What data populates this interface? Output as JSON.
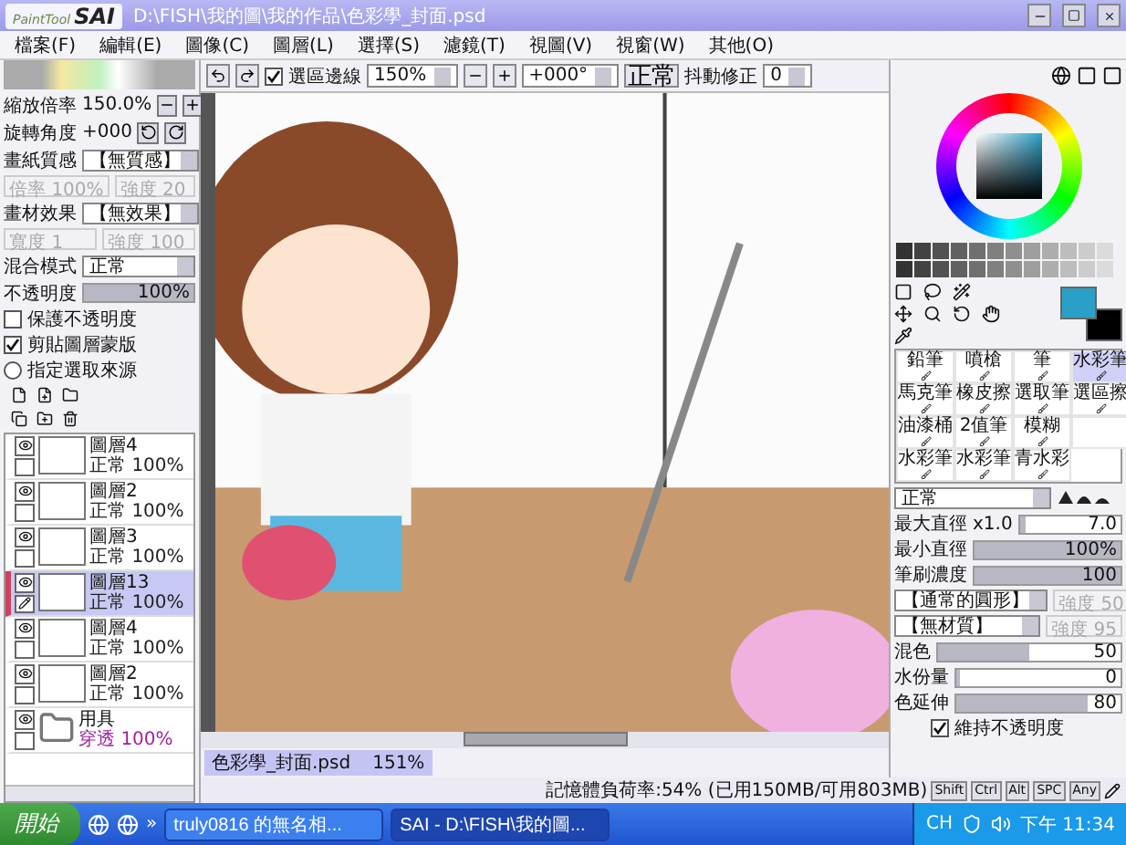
{
  "window": {
    "logo_small": "PaintTool",
    "logo": "SAI",
    "title": "D:\\FISH\\我的圖\\我的作品\\色彩學_封面.psd"
  },
  "menu": [
    "檔案(F)",
    "編輯(E)",
    "圖像(C)",
    "圖層(L)",
    "選擇(S)",
    "濾鏡(T)",
    "視圖(V)",
    "視窗(W)",
    "其他(O)"
  ],
  "toolbar": {
    "selection_edge": {
      "label": "選區邊線",
      "checked": true
    },
    "zoom": "150%",
    "rotation": "+000°",
    "blend": "正常",
    "stabilizer_label": "抖動修正",
    "stabilizer": "0"
  },
  "navigator": {
    "zoom_label": "縮放倍率",
    "zoom": "150.0%",
    "rotate_label": "旋轉角度",
    "rotate": "+000"
  },
  "paper": {
    "label": "畫紙質感",
    "value": "【無質感】",
    "fields": [
      {
        "label": "倍率",
        "value": "100%"
      },
      {
        "label": "強度",
        "value": "20"
      }
    ]
  },
  "effect": {
    "label": "畫材效果",
    "value": "【無效果】",
    "fields": [
      {
        "label": "寬度",
        "value": "1"
      },
      {
        "label": "強度",
        "value": "100"
      }
    ]
  },
  "layer_props": {
    "blend_label": "混合模式",
    "blend": "正常",
    "opacity_label": "不透明度",
    "opacity": "100%",
    "opacity_level": {
      "level": 1
    },
    "options": [
      {
        "kind": "checkbox",
        "label": "保護不透明度",
        "checked": false
      },
      {
        "kind": "checkbox",
        "label": "剪貼圖層蒙版",
        "checked": true
      },
      {
        "kind": "radio",
        "label": "指定選取來源",
        "checked": false
      }
    ]
  },
  "layers": [
    {
      "kind": "layer",
      "name": "圖層4",
      "mode": "正常",
      "opacity": "100%",
      "selected": false
    },
    {
      "kind": "layer",
      "name": "圖層2",
      "mode": "正常",
      "opacity": "100%",
      "selected": false
    },
    {
      "kind": "layer",
      "name": "圖層3",
      "mode": "正常",
      "opacity": "100%",
      "selected": false
    },
    {
      "kind": "layer",
      "name": "圖層13",
      "mode": "正常",
      "opacity": "100%",
      "selected": true
    },
    {
      "kind": "layer",
      "name": "圖層4",
      "mode": "正常",
      "opacity": "100%",
      "selected": false
    },
    {
      "kind": "layer",
      "name": "圖層2",
      "mode": "正常",
      "opacity": "100%",
      "selected": false
    },
    {
      "kind": "folder",
      "name": "用具",
      "mode": "穿透",
      "opacity": "100%",
      "selected": false
    }
  ],
  "file_tabs": [
    {
      "name": "色彩學_封面.psd",
      "zoom": "151%",
      "selected": true
    }
  ],
  "tools": [
    {
      "name": "鉛筆",
      "selected": false
    },
    {
      "name": "噴槍",
      "selected": false
    },
    {
      "name": "筆",
      "selected": false
    },
    {
      "name": "水彩筆",
      "selected": true
    },
    {
      "name": "馬克筆",
      "selected": false
    },
    {
      "name": "橡皮擦",
      "selected": false
    },
    {
      "name": "選取筆",
      "selected": false
    },
    {
      "name": "選區擦",
      "selected": false
    },
    {
      "name": "油漆桶",
      "selected": false
    },
    {
      "name": "2值筆",
      "selected": false
    },
    {
      "name": "模糊",
      "selected": false
    },
    {
      "selected": false
    },
    {
      "name": "水彩筆",
      "selected": false
    },
    {
      "name": "水彩筆",
      "selected": false
    },
    {
      "name": "青水彩",
      "selected": false
    }
  ],
  "brush": {
    "mode": "正常",
    "sliders": [
      {
        "label": "最大直徑",
        "extra": "x1.0",
        "value": "7.0",
        "level": 0.05
      },
      {
        "label": "最小直徑",
        "value": "100%",
        "level": 1
      },
      {
        "label": "筆刷濃度",
        "value": "100",
        "level": 1
      }
    ],
    "shapes": [
      {
        "value": "【通常的圓形】",
        "strength_label": "強度",
        "strength": "50"
      },
      {
        "value": "【無材質】",
        "strength_label": "強度",
        "strength": "95"
      }
    ],
    "mix": [
      {
        "label": "混色",
        "value": "50",
        "level": 0.5
      },
      {
        "label": "水份量",
        "value": "0",
        "level": 0
      },
      {
        "label": "色延伸",
        "value": "80",
        "level": 0.8
      }
    ],
    "keep_opacity": {
      "label": "維持不透明度",
      "checked": true
    }
  },
  "status": {
    "memory": "記憶體負荷率:54% (已用150MB/可用803MB)",
    "keys": [
      "Shift",
      "Ctrl",
      "Alt",
      "SPC",
      "Any"
    ]
  },
  "taskbar": {
    "start": "開始",
    "chevron": "»",
    "tasks": [
      {
        "label": "truly0816 的無名相...",
        "selected": false
      },
      {
        "label": "SAI - D:\\FISH\\我的圖...",
        "selected": true
      }
    ],
    "lang": "CH",
    "clock": "下午 11:34"
  }
}
